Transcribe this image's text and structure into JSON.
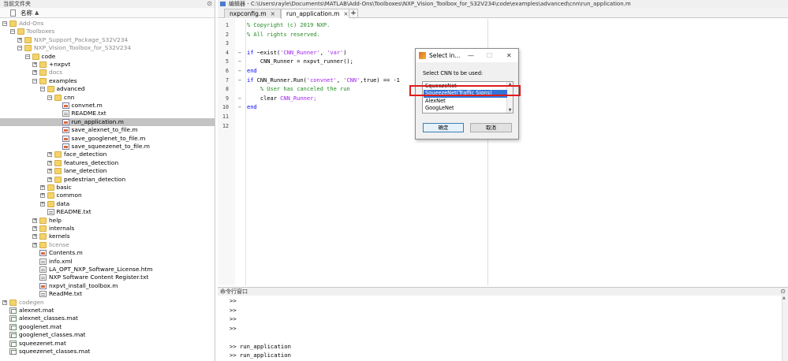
{
  "left_panel": {
    "title": "当前文件夹",
    "column_header": "名称",
    "sort_arrow": "▲",
    "tree": [
      {
        "label": "Add-Ons",
        "icon": "folder-icon",
        "expander": "−",
        "gray": true
      },
      {
        "label": "Toolboxes",
        "icon": "folder-icon",
        "expander": "−",
        "gray": true
      },
      {
        "label": "NXP_Support_Package_S32V234",
        "icon": "folder-icon",
        "expander": "+",
        "gray": true
      },
      {
        "label": "NXP_Vision_Toolbox_for_S32V234",
        "icon": "folder-icon",
        "expander": "−",
        "gray": true
      },
      {
        "label": "code",
        "icon": "folder-icon",
        "expander": "−"
      },
      {
        "label": "+nxpvt",
        "icon": "folder-icon",
        "expander": "+"
      },
      {
        "label": "docs",
        "icon": "folder-icon",
        "expander": "+",
        "gray": true
      },
      {
        "label": "examples",
        "icon": "folder-icon",
        "expander": "−"
      },
      {
        "label": "advanced",
        "icon": "folder-icon",
        "expander": "−"
      },
      {
        "label": "cnn",
        "icon": "folder-icon",
        "expander": "−"
      },
      {
        "label": "convnet.m",
        "icon": "m-file-icon"
      },
      {
        "label": "README.txt",
        "icon": "text-file-icon"
      },
      {
        "label": "run_application.m",
        "icon": "m-file-icon",
        "selected": true
      },
      {
        "label": "save_alexnet_to_file.m",
        "icon": "m-file-icon"
      },
      {
        "label": "save_googlenet_to_file.m",
        "icon": "m-file-icon"
      },
      {
        "label": "save_squeezenet_to_file.m",
        "icon": "m-file-icon"
      },
      {
        "label": "face_detection",
        "icon": "folder-icon",
        "expander": "+"
      },
      {
        "label": "features_detection",
        "icon": "folder-icon",
        "expander": "+"
      },
      {
        "label": "lane_detection",
        "icon": "folder-icon",
        "expander": "+"
      },
      {
        "label": "pedestrian_detection",
        "icon": "folder-icon",
        "expander": "+"
      },
      {
        "label": "basic",
        "icon": "folder-icon",
        "expander": "+"
      },
      {
        "label": "common",
        "icon": "folder-icon",
        "expander": "+"
      },
      {
        "label": "data",
        "icon": "folder-icon",
        "expander": "+"
      },
      {
        "label": "README.txt",
        "icon": "text-file-icon"
      },
      {
        "label": "help",
        "icon": "folder-icon",
        "expander": "+"
      },
      {
        "label": "internals",
        "icon": "folder-icon",
        "expander": "+"
      },
      {
        "label": "kernels",
        "icon": "folder-icon",
        "expander": "+"
      },
      {
        "label": "license",
        "icon": "folder-icon",
        "expander": "+",
        "gray": true
      },
      {
        "label": "Contents.m",
        "icon": "m-file-icon"
      },
      {
        "label": "info.xml",
        "icon": "text-file-icon"
      },
      {
        "label": "LA_OPT_NXP_Software_License.htm",
        "icon": "text-file-icon"
      },
      {
        "label": "NXP Software Content Register.txt",
        "icon": "text-file-icon"
      },
      {
        "label": "nxpvt_install_toolbox.m",
        "icon": "m-file-icon"
      },
      {
        "label": "ReadMe.txt",
        "icon": "text-file-icon"
      },
      {
        "label": "codegen",
        "icon": "folder-icon",
        "expander": "+",
        "gray": true
      },
      {
        "label": "alexnet.mat",
        "icon": "mat-file-icon"
      },
      {
        "label": "alexnet_classes.mat",
        "icon": "mat-file-icon"
      },
      {
        "label": "googlenet.mat",
        "icon": "mat-file-icon"
      },
      {
        "label": "googlenet_classes.mat",
        "icon": "mat-file-icon"
      },
      {
        "label": "squeezenet.mat",
        "icon": "mat-file-icon"
      },
      {
        "label": "squeezenet_classes.mat",
        "icon": "mat-file-icon"
      }
    ]
  },
  "editor": {
    "title": "编辑器 - C:\\Users\\rayle\\Documents\\MATLAB\\Add-Ons\\Toolboxes\\NXP_Vision_Toolbox_for_S32V234\\code\\examples\\advanced\\cnn\\run_application.m",
    "tabs": [
      {
        "label": "nxpconfig.m",
        "close": "×"
      },
      {
        "label": "run_application.m",
        "close": "×",
        "active": true
      }
    ],
    "add_tab": "+",
    "lines": [
      {
        "n": "1",
        "fold": "",
        "tokens": [
          {
            "t": "% Copyright (c) 2019 NXP.",
            "c": "comment"
          }
        ]
      },
      {
        "n": "2",
        "fold": "",
        "tokens": [
          {
            "t": "% All rights reserved.",
            "c": "comment"
          }
        ]
      },
      {
        "n": "3",
        "fold": "",
        "tokens": []
      },
      {
        "n": "4",
        "fold": "−",
        "tokens": [
          {
            "t": "if ",
            "c": "kw"
          },
          {
            "t": "~exist(",
            "c": "plain"
          },
          {
            "t": "'CNN_Runner'",
            "c": "str"
          },
          {
            "t": ", ",
            "c": "plain"
          },
          {
            "t": "'var'",
            "c": "str"
          },
          {
            "t": ")",
            "c": "plain"
          }
        ]
      },
      {
        "n": "5",
        "fold": "−",
        "tokens": [
          {
            "t": "    CNN_Runner = nxpvt_runner();",
            "c": "plain"
          }
        ]
      },
      {
        "n": "6",
        "fold": "−",
        "tokens": [
          {
            "t": "end",
            "c": "kw"
          }
        ]
      },
      {
        "n": "7",
        "fold": "−",
        "tokens": [
          {
            "t": "if ",
            "c": "kw"
          },
          {
            "t": "CNN_Runner.Run(",
            "c": "plain"
          },
          {
            "t": "'convnet'",
            "c": "str"
          },
          {
            "t": ", ",
            "c": "plain"
          },
          {
            "t": "'CNN'",
            "c": "str"
          },
          {
            "t": ",true) == -1",
            "c": "plain"
          }
        ]
      },
      {
        "n": "8",
        "fold": "",
        "tokens": [
          {
            "t": "    % User has canceled the run",
            "c": "comment"
          }
        ]
      },
      {
        "n": "9",
        "fold": "−",
        "tokens": [
          {
            "t": "    clear ",
            "c": "plain"
          },
          {
            "t": "CNN_Runner;",
            "c": "str"
          }
        ]
      },
      {
        "n": "10",
        "fold": "−",
        "tokens": [
          {
            "t": "end",
            "c": "kw"
          }
        ]
      },
      {
        "n": "11",
        "fold": "",
        "tokens": []
      },
      {
        "n": "12",
        "fold": "",
        "tokens": []
      }
    ]
  },
  "command_window": {
    "title": "命令行窗口",
    "lines": [
      ">>",
      ">>",
      ">>",
      ">>",
      "",
      ">> run_application",
      ">> run_application",
      ">> run_application"
    ]
  },
  "dialog": {
    "title": "Select in...",
    "minimize": "—",
    "maximize": "☐",
    "close": "✕",
    "prompt": "Select CNN to be used:",
    "options": [
      "SqueezeNet",
      "SqueezeNet(Traffic Signs)",
      "AlexNet",
      "GoogLeNet"
    ],
    "selected_index": 1,
    "ok_label": "确定",
    "cancel_label": "取消",
    "scroll_up": "▲",
    "scroll_down": "▼"
  },
  "colors": {
    "highlight_box": "#e01b1b",
    "selection": "#3372d6",
    "comment": "#228b22",
    "keyword": "#0000ff",
    "string": "#a020f0"
  }
}
